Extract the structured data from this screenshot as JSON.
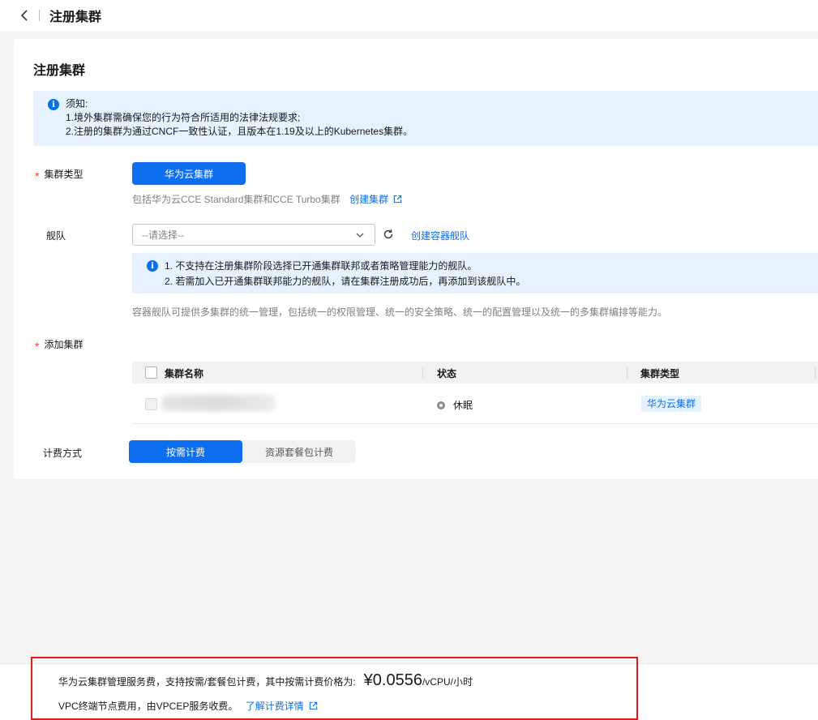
{
  "header": {
    "title": "注册集群"
  },
  "card": {
    "title": "注册集群",
    "notice": {
      "heading": "须知:",
      "line1": "1.境外集群需确保您的行为符合所适用的法律法规要求;",
      "line2": "2.注册的集群为通过CNCF一致性认证，且版本在1.19及以上的Kubernetes集群。"
    }
  },
  "form": {
    "cluster_type": {
      "label": "集群类型",
      "selected_option": "华为云集群",
      "hint": "包括华为云CCE Standard集群和CCE Turbo集群",
      "create_link": "创建集群"
    },
    "fleet": {
      "label": "舰队",
      "placeholder": "--请选择--",
      "create_link": "创建容器舰队",
      "notice_line1": "1. 不支持在注册集群阶段选择已开通集群联邦或者策略管理能力的舰队。",
      "notice_line2": "2. 若需加入已开通集群联邦能力的舰队，请在集群注册成功后，再添加到该舰队中。",
      "description": "容器舰队可提供多集群的统一管理，包括统一的权限管理、统一的安全策略、统一的配置管理以及统一的多集群编排等能力。"
    },
    "add_cluster": {
      "label": "添加集群",
      "columns": [
        "集群名称",
        "状态",
        "集群类型"
      ],
      "rows": [
        {
          "name": "",
          "status": "休眠",
          "type": "华为云集群"
        }
      ]
    },
    "billing": {
      "label": "计费方式",
      "options": [
        "按需计费",
        "资源套餐包计费"
      ],
      "selected": "按需计费"
    }
  },
  "footer": {
    "line1_prefix": "华为云集群管理服务费，支持按需/套餐包计费，其中按需计费价格为:",
    "price": "¥0.0556",
    "unit": "/vCPU/小时",
    "line2_prefix": "VPC终端节点费用，由VPCEP服务收费。",
    "line2_link": "了解计费详情"
  },
  "colors": {
    "primary": "#0d6ff0",
    "notice_bg": "#e6f2ff",
    "highlight_border": "#e01b1b"
  }
}
